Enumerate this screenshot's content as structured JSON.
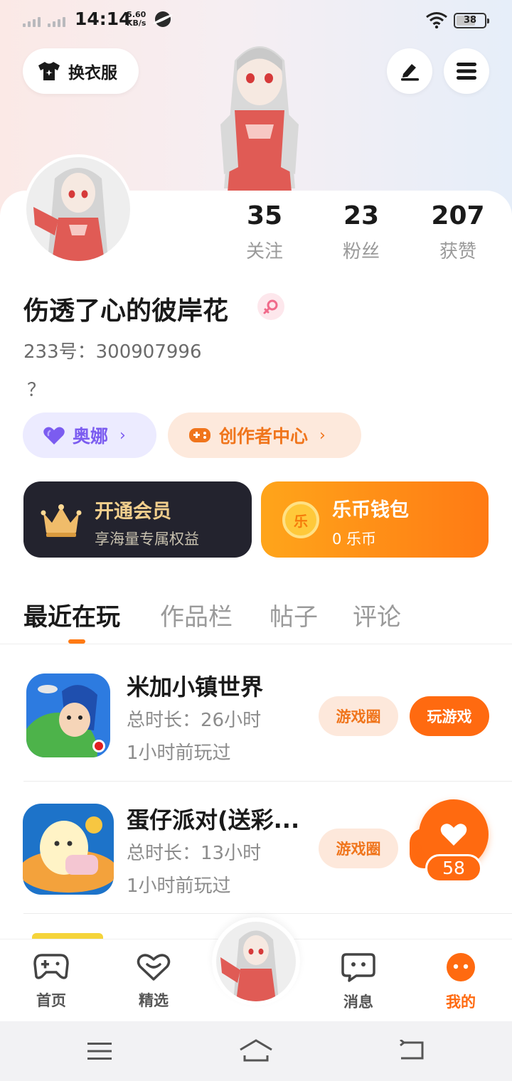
{
  "status_bar": {
    "time": "14:14",
    "net_speed_value": "5.60",
    "net_speed_unit": "KB/s",
    "battery_level": "38"
  },
  "header": {
    "outfit_label": "换衣服",
    "edit_icon": "pencil-icon",
    "menu_icon": "hamburger-icon"
  },
  "profile": {
    "stats": [
      {
        "value": "35",
        "label": "关注"
      },
      {
        "value": "23",
        "label": "粉丝"
      },
      {
        "value": "207",
        "label": "获赞"
      }
    ],
    "username": "伤透了心的彼岸花",
    "gender_icon": "female-icon",
    "user_id": "233号：300907996",
    "bio": "？"
  },
  "pills": {
    "ona_label": "奥娜",
    "creator_label": "创作者中心"
  },
  "promo": {
    "vip_title": "开通会员",
    "vip_subtitle": "享海量专属权益",
    "wallet_title": "乐币钱包",
    "wallet_balance": "0 乐币",
    "coin_glyph": "乐"
  },
  "tabs": [
    "最近在玩",
    "作品栏",
    "帖子",
    "评论"
  ],
  "games": [
    {
      "name": "米加小镇世界",
      "duration": "总时长：26小时",
      "last_played": "1小时前玩过",
      "circle_label": "游戏圈",
      "play_label": "玩游戏"
    },
    {
      "name": "蛋仔派对(送彩...",
      "duration": "总时长：13小时",
      "last_played": "1小时前玩过",
      "circle_label": "游戏圈"
    }
  ],
  "floating_like": {
    "count": "58"
  },
  "bottom_nav": [
    {
      "label": "首页",
      "icon": "gamepad-icon"
    },
    {
      "label": "精选",
      "icon": "heart-chat-icon"
    },
    {
      "label": "消息",
      "icon": "message-icon"
    },
    {
      "label": "我的",
      "icon": "me-icon"
    }
  ],
  "colors": {
    "accent": "#ff6a10",
    "vip_gold": "#f2cf8d",
    "ona_purple": "#7b5cf0"
  }
}
